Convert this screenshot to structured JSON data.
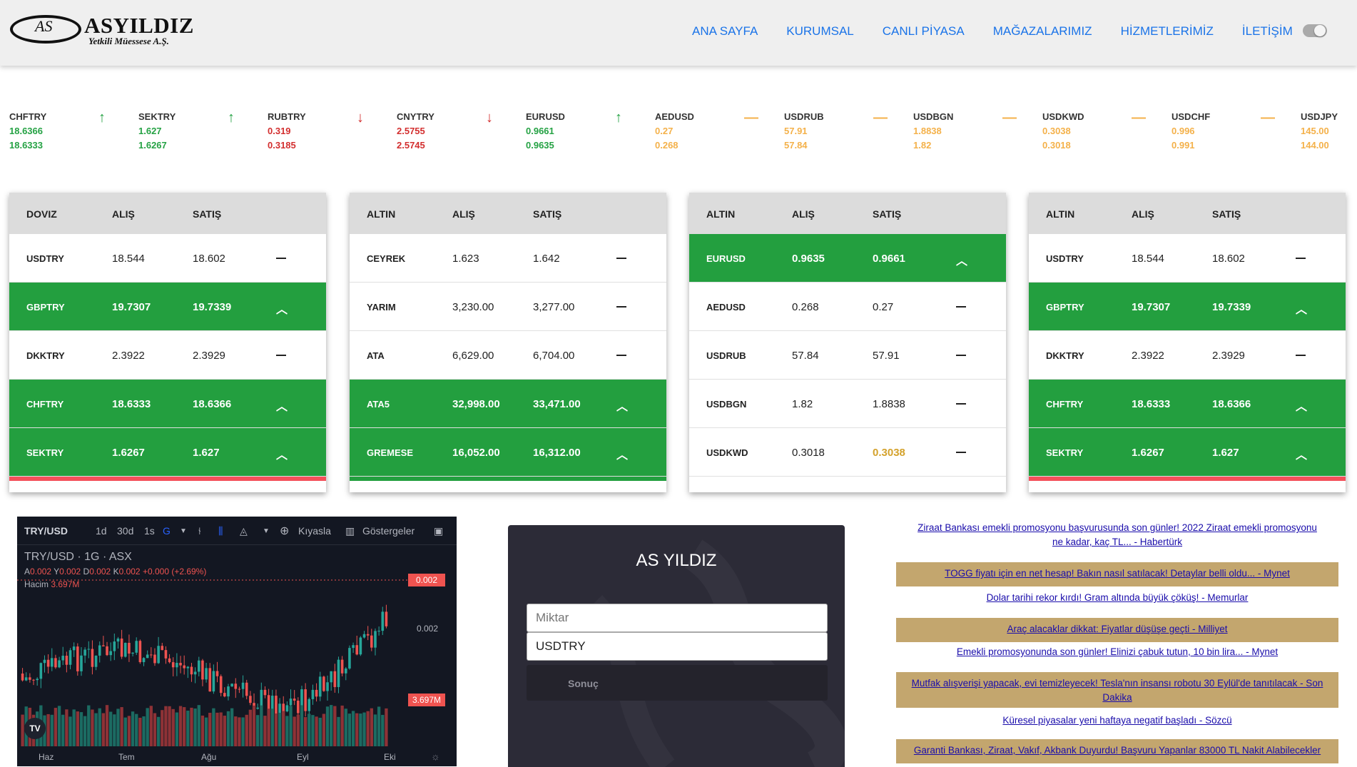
{
  "brand": {
    "logo_mark": "AS",
    "name": "ASYILDIZ",
    "subtitle": "Yetkili Müessese A.Ş."
  },
  "nav": [
    "ANA SAYFA",
    "KURUMSAL",
    "CANLI PİYASA",
    "MAĞAZALARIMIZ",
    "HİZMETLERİMİZ",
    "İLETİŞİM"
  ],
  "ticker": [
    {
      "name": "CHFTRY",
      "v1": "18.6366",
      "v2": "18.6333",
      "dir": "up"
    },
    {
      "name": "SEKTRY",
      "v1": "1.627",
      "v2": "1.6267",
      "dir": "up"
    },
    {
      "name": "RUBTRY",
      "v1": "0.319",
      "v2": "0.3185",
      "dir": "down"
    },
    {
      "name": "CNYTRY",
      "v1": "2.5755",
      "v2": "2.5745",
      "dir": "down"
    },
    {
      "name": "EURUSD",
      "v1": "0.9661",
      "v2": "0.9635",
      "dir": "up"
    },
    {
      "name": "AEDUSD",
      "v1": "0.27",
      "v2": "0.268",
      "dir": "flat"
    },
    {
      "name": "USDRUB",
      "v1": "57.91",
      "v2": "57.84",
      "dir": "flat"
    },
    {
      "name": "USDBGN",
      "v1": "1.8838",
      "v2": "1.82",
      "dir": "flat"
    },
    {
      "name": "USDKWD",
      "v1": "0.3038",
      "v2": "0.3018",
      "dir": "flat"
    },
    {
      "name": "USDCHF",
      "v1": "0.996",
      "v2": "0.991",
      "dir": "flat"
    },
    {
      "name": "USDJPY",
      "v1": "145.00",
      "v2": "144.00",
      "dir": "flat"
    }
  ],
  "tables": [
    {
      "headers": [
        "DOVIZ",
        "ALIŞ",
        "SATIŞ"
      ],
      "rows": [
        {
          "name": "USDTRY",
          "buy": "18.544",
          "sell": "18.602",
          "state": "flat"
        },
        {
          "name": "GBPTRY",
          "buy": "19.7307",
          "sell": "19.7339",
          "state": "up"
        },
        {
          "name": "DKKTRY",
          "buy": "2.3922",
          "sell": "2.3929",
          "state": "flat"
        },
        {
          "name": "CHFTRY",
          "buy": "18.6333",
          "sell": "18.6366",
          "state": "up"
        },
        {
          "name": "SEKTRY",
          "buy": "1.6267",
          "sell": "1.627",
          "state": "up"
        }
      ]
    },
    {
      "headers": [
        "ALTIN",
        "ALIŞ",
        "SATIŞ"
      ],
      "rows": [
        {
          "name": "CEYREK",
          "buy": "1.623",
          "sell": "1.642",
          "state": "flat"
        },
        {
          "name": "YARIM",
          "buy": "3,230.00",
          "sell": "3,277.00",
          "state": "flat"
        },
        {
          "name": "ATA",
          "buy": "6,629.00",
          "sell": "6,704.00",
          "state": "flat"
        },
        {
          "name": "ATA5",
          "buy": "32,998.00",
          "sell": "33,471.00",
          "state": "up"
        },
        {
          "name": "GREMESE",
          "buy": "16,052.00",
          "sell": "16,312.00",
          "state": "up"
        }
      ]
    },
    {
      "headers": [
        "ALTIN",
        "ALIŞ",
        "SATIŞ"
      ],
      "rows": [
        {
          "name": "EURUSD",
          "buy": "0.9635",
          "sell": "0.9661",
          "state": "up"
        },
        {
          "name": "AEDUSD",
          "buy": "0.268",
          "sell": "0.27",
          "state": "flat"
        },
        {
          "name": "USDRUB",
          "buy": "57.84",
          "sell": "57.91",
          "state": "flat"
        },
        {
          "name": "USDBGN",
          "buy": "1.82",
          "sell": "1.8838",
          "state": "flat"
        },
        {
          "name": "USDKWD",
          "buy": "0.3018",
          "sell": "0.3038",
          "state": "flat",
          "sell_highlight": true
        }
      ]
    },
    {
      "headers": [
        "ALTIN",
        "ALIŞ",
        "SATIŞ"
      ],
      "rows": [
        {
          "name": "USDTRY",
          "buy": "18.544",
          "sell": "18.602",
          "state": "flat"
        },
        {
          "name": "GBPTRY",
          "buy": "19.7307",
          "sell": "19.7339",
          "state": "up"
        },
        {
          "name": "DKKTRY",
          "buy": "2.3922",
          "sell": "2.3929",
          "state": "flat"
        },
        {
          "name": "CHFTRY",
          "buy": "18.6333",
          "sell": "18.6366",
          "state": "up"
        },
        {
          "name": "SEKTRY",
          "buy": "1.6267",
          "sell": "1.627",
          "state": "up"
        }
      ]
    }
  ],
  "chart_widget": {
    "symbol": "TRY/USD",
    "intervals": [
      "1d",
      "30d",
      "1s"
    ],
    "active_interval": "G",
    "compare_label": "Kıyasla",
    "indicators_label": "Göstergeler",
    "title": "TRY/USD · 1G · ASX",
    "ohlc": {
      "a": "0.002",
      "y": "0.002",
      "d": "0.002",
      "k": "0.002",
      "change": "+0.000 (+2.69%)"
    },
    "volume_label": "Hacim",
    "volume_value": "3.697M",
    "price_label": "0.002",
    "price_axis_mid": "0.002",
    "volume_axis_label": "3.697M",
    "x_labels": [
      "Haz",
      "Tem",
      "Ağu",
      "Eyl",
      "Eki"
    ],
    "logo": "TV"
  },
  "converter": {
    "title": "AS YILDIZ",
    "amount_placeholder": "Miktar",
    "currency_value": "USDTRY",
    "result_label": "Sonuç"
  },
  "news": [
    "Ziraat Bankası emekli promosyonu başvurusunda son günler! 2022 Ziraat emekli promosyonu ne kadar, kaç TL... - Habertürk",
    "TOGG fiyatı için en net hesap! Bakın nasıl satılacak! Detaylar belli oldu... - Mynet",
    "Dolar tarihi rekor kırdı! Gram altında büyük çöküş! - Memurlar",
    "Araç alacaklar dikkat: Fiyatlar düşüşe geçti - Milliyet",
    "Emekli promosyonunda son günler! Elinizi çabuk tutun, 10 bin lira... - Mynet",
    "Mutfak alışverişi yapacak, evi temizleyecek! Tesla'nın insansı robotu 30 Eylül'de tanıtılacak - Son Dakika",
    "Küresel piyasalar yeni haftaya negatif başladı - Sözcü",
    "Garanti Bankası, Ziraat, Vakıf, Akbank Duyurdu! Başvuru Yapanlar 83000 TL Nakit Alabilecekler"
  ],
  "colors": {
    "up": "#25a244",
    "down": "#d32f2f",
    "flat": "#f4b14a",
    "row_green": "#239f3f",
    "nav": "#1a73e8",
    "news_tan": "#c3a66e"
  }
}
